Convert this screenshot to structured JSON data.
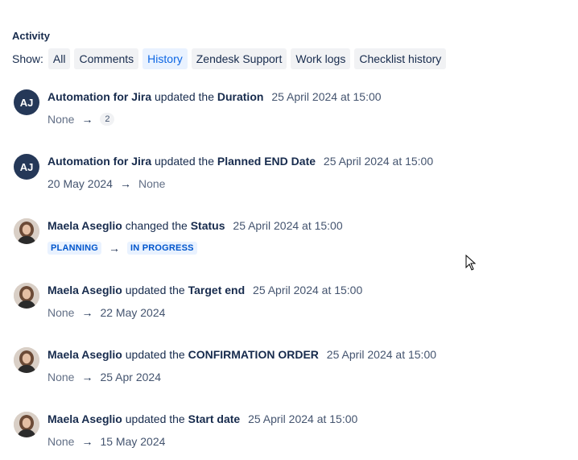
{
  "activity": {
    "title": "Activity",
    "show_label": "Show:",
    "filters": [
      {
        "label": "All",
        "active": false
      },
      {
        "label": "Comments",
        "active": false
      },
      {
        "label": "History",
        "active": true
      },
      {
        "label": "Zendesk Support",
        "active": false
      },
      {
        "label": "Work logs",
        "active": false
      },
      {
        "label": "Checklist history",
        "active": false
      }
    ]
  },
  "entries": [
    {
      "avatar": {
        "type": "initials",
        "text": "AJ"
      },
      "author": "Automation for Jira",
      "verb": "updated the",
      "field": "Duration",
      "timestamp": "25 April 2024 at 15:00",
      "from": "None",
      "arrow": "→",
      "to": "2"
    },
    {
      "avatar": {
        "type": "initials",
        "text": "AJ"
      },
      "author": "Automation for Jira",
      "verb": "updated the",
      "field": "Planned END Date",
      "timestamp": "25 April 2024 at 15:00",
      "from": "20 May 2024",
      "arrow": "→",
      "to": "None"
    },
    {
      "avatar": {
        "type": "photo"
      },
      "author": "Maela Aseglio",
      "verb": "changed the",
      "field": "Status",
      "timestamp": "25 April 2024 at 15:00",
      "from": "PLANNING",
      "arrow": "→",
      "to": "IN PROGRESS"
    },
    {
      "avatar": {
        "type": "photo"
      },
      "author": "Maela Aseglio",
      "verb": "updated the",
      "field": "Target end",
      "timestamp": "25 April 2024 at 15:00",
      "from": "None",
      "arrow": "→",
      "to": "22 May 2024"
    },
    {
      "avatar": {
        "type": "photo"
      },
      "author": "Maela Aseglio",
      "verb": "updated the",
      "field": "CONFIRMATION ORDER",
      "timestamp": "25 April 2024 at 15:00",
      "from": "None",
      "arrow": "→",
      "to": "25 Apr 2024"
    },
    {
      "avatar": {
        "type": "photo"
      },
      "author": "Maela Aseglio",
      "verb": "updated the",
      "field": "Start date",
      "timestamp": "25 April 2024 at 15:00",
      "from": "None",
      "arrow": "→",
      "to": "15 May 2024"
    }
  ],
  "colors": {
    "active_filter_bg": "#e9f2ff",
    "active_filter_text": "#0c66e4",
    "filter_bg": "#f1f2f4",
    "avatar_initials_bg": "#253858",
    "status_lozenge_bg": "#e9f2ff",
    "status_lozenge_text": "#0055cc"
  },
  "icons": {
    "arrow": "right-arrow-icon",
    "cursor": "mouse-pointer-icon"
  }
}
